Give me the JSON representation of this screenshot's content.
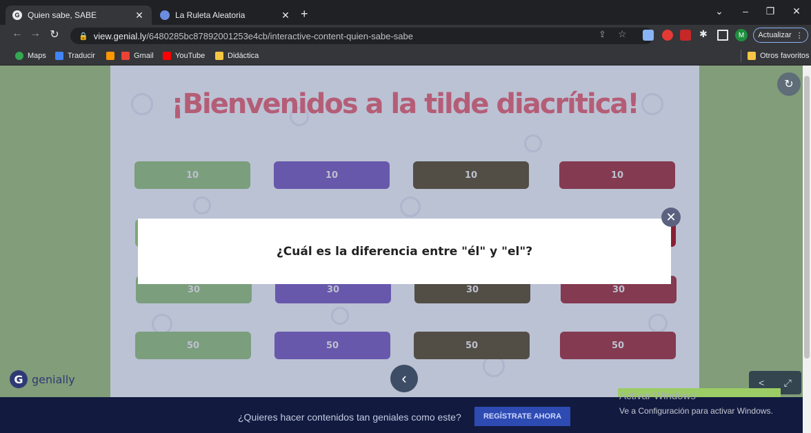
{
  "browser": {
    "tabs": [
      {
        "title": "Quien sabe, SABE",
        "active": true
      },
      {
        "title": "La Ruleta Aleatoria",
        "active": false
      }
    ],
    "new_tab": "+",
    "url_host": "view.genial.ly",
    "url_path": "/6480285bc87892001253e4cb/interactive-content-quien-sabe-sabe",
    "update_label": "Actualizar",
    "profile_initial": "M",
    "bookmarks": [
      "Maps",
      "Traducir",
      "Gmail",
      "YouTube",
      "Didáctica"
    ],
    "other_bookmarks": "Otros favoritos"
  },
  "game": {
    "title": "¡Bienvenidos a la tilde diacrítica!",
    "rows": [
      {
        "points": [
          "10",
          "10",
          "10",
          "10"
        ]
      },
      {
        "points": [
          "30",
          "30",
          "30",
          "30"
        ]
      },
      {
        "points": [
          "50",
          "50",
          "50",
          "50"
        ]
      }
    ],
    "column_colors": [
      "#7da970",
      "#6248b0",
      "#443a22",
      "#8a1f33"
    ]
  },
  "modal": {
    "question": "¿Cuál es la diferencia entre \"él\" y \"el\"?",
    "close_glyph": "✕"
  },
  "footer": {
    "logo_text": "genially",
    "banner_text": "¿Quieres hacer contenidos tan geniales como este?",
    "register_label": "REGÍSTRATE AHORA"
  },
  "windows_activation": {
    "title": "Activar Windows",
    "subtitle": "Ve a Configuración para activar Windows."
  }
}
